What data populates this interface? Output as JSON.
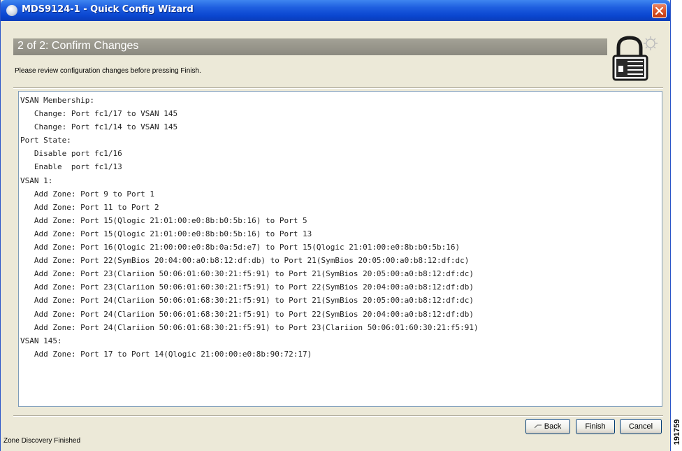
{
  "window": {
    "title": "MDS9124-1 - Quick Config Wizard",
    "title_bar_color": "#0b47d0",
    "close_icon": "close-x-icon"
  },
  "header": {
    "title": "2 of 2: Confirm Changes",
    "subtitle": "Please review configuration changes before pressing Finish.",
    "icon": "security-lock-gear-icon"
  },
  "content": {
    "lines": [
      "VSAN Membership:",
      "   Change: Port fc1/17 to VSAN 145",
      "   Change: Port fc1/14 to VSAN 145",
      "Port State:",
      "   Disable port fc1/16",
      "   Enable  port fc1/13",
      "VSAN 1:",
      "   Add Zone: Port 9 to Port 1",
      "   Add Zone: Port 11 to Port 2",
      "   Add Zone: Port 15(Qlogic 21:01:00:e0:8b:b0:5b:16) to Port 5",
      "   Add Zone: Port 15(Qlogic 21:01:00:e0:8b:b0:5b:16) to Port 13",
      "   Add Zone: Port 16(Qlogic 21:00:00:e0:8b:0a:5d:e7) to Port 15(Qlogic 21:01:00:e0:8b:b0:5b:16)",
      "   Add Zone: Port 22(SymBios 20:04:00:a0:b8:12:df:db) to Port 21(SymBios 20:05:00:a0:b8:12:df:dc)",
      "   Add Zone: Port 23(Clariion 50:06:01:60:30:21:f5:91) to Port 21(SymBios 20:05:00:a0:b8:12:df:dc)",
      "   Add Zone: Port 23(Clariion 50:06:01:60:30:21:f5:91) to Port 22(SymBios 20:04:00:a0:b8:12:df:db)",
      "   Add Zone: Port 24(Clariion 50:06:01:68:30:21:f5:91) to Port 21(SymBios 20:05:00:a0:b8:12:df:dc)",
      "   Add Zone: Port 24(Clariion 50:06:01:68:30:21:f5:91) to Port 22(SymBios 20:04:00:a0:b8:12:df:db)",
      "   Add Zone: Port 24(Clariion 50:06:01:68:30:21:f5:91) to Port 23(Clariion 50:06:01:60:30:21:f5:91)",
      "VSAN 145:",
      "   Add Zone: Port 17 to Port 14(Qlogic 21:00:00:e0:8b:90:72:17)"
    ]
  },
  "buttons": {
    "back": "Back",
    "finish": "Finish",
    "cancel": "Cancel",
    "back_icon": "back-arrow-icon"
  },
  "status": {
    "text": "Zone Discovery Finished"
  },
  "figure_number": "191759"
}
